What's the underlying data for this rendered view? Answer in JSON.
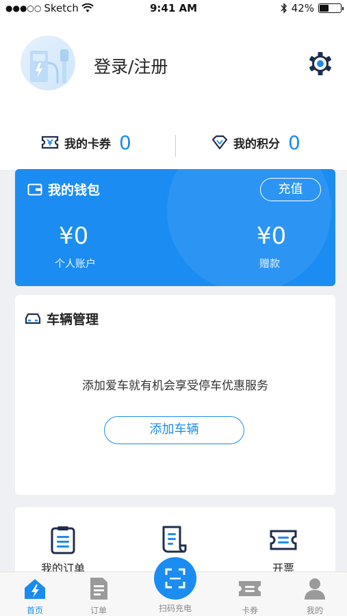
{
  "status_bar": {
    "carrier": "Sketch",
    "time": "9:41 AM",
    "battery": "42%",
    "battery_level": 0.42
  },
  "profile": {
    "login_label": "登录/注册"
  },
  "stats": {
    "coupons_label": "我的卡券",
    "coupons_value": "0",
    "points_label": "我的积分",
    "points_value": "0"
  },
  "wallet": {
    "title": "我的钱包",
    "recharge_label": "充值",
    "personal_amount": "¥0",
    "personal_label": "个人账户",
    "gift_amount": "¥0",
    "gift_label": "赠款"
  },
  "vehicle": {
    "title": "车辆管理",
    "description": "添加爱车就有机会享受停车优惠服务",
    "add_label": "添加车辆"
  },
  "shortcuts": {
    "orders_label": "我的订单",
    "invoice_label": "开票"
  },
  "tab_bar": {
    "home": "首页",
    "orders": "订单",
    "scan": "扫码充电",
    "cards": "卡券",
    "mine": "我的"
  },
  "colors": {
    "accent": "#1b8df2",
    "navy": "#1f2d4d"
  }
}
